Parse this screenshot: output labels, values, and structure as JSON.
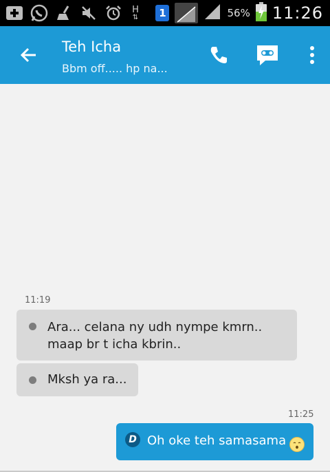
{
  "status_bar": {
    "sim_slot": "1",
    "network_type": "H",
    "battery_percent": "56%",
    "time": "11:26",
    "icons": [
      "add-notification-icon",
      "whatsapp-icon",
      "cleaner-icon",
      "mute-icon",
      "alarm-icon",
      "data-arrows-icon",
      "sim-icon",
      "signal-icon",
      "battery-charging-icon"
    ]
  },
  "header": {
    "contact_name": "Teh Icha",
    "status_message": "Bbm off..... hp na...",
    "colors": {
      "bar": "#1d9ad6"
    }
  },
  "messages": {
    "incoming_time": "11:19",
    "incoming": [
      {
        "line1": "Ara... celana ny udh nympe kmrn..",
        "line2": "maap br t icha kbrin.."
      },
      {
        "line1": "Mksh ya ra..."
      }
    ],
    "outgoing_time": "11:25",
    "outgoing": {
      "sender_badge": "D",
      "text": "Oh oke teh samasama",
      "emoji": "blush-emoji"
    }
  }
}
